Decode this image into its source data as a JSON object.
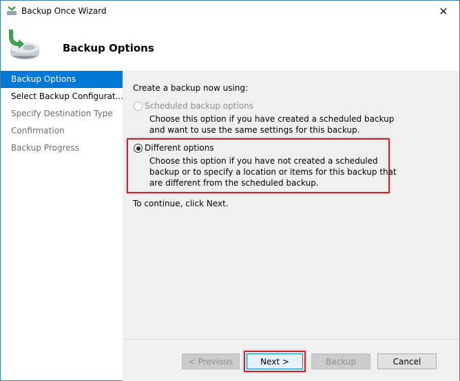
{
  "window": {
    "title": "Backup Once Wizard"
  },
  "header": {
    "title": "Backup Options"
  },
  "sidebar": {
    "items": [
      {
        "label": "Backup Options",
        "state": "active"
      },
      {
        "label": "Select Backup Configurat...",
        "state": "normal"
      },
      {
        "label": "Specify Destination Type",
        "state": "disabled"
      },
      {
        "label": "Confirmation",
        "state": "disabled"
      },
      {
        "label": "Backup Progress",
        "state": "disabled"
      }
    ]
  },
  "content": {
    "intro": "Create a backup now using:",
    "options": [
      {
        "label": "Scheduled backup options",
        "description": "Choose this option if you have created a scheduled backup and want to use the same settings for this backup.",
        "enabled": false,
        "selected": false
      },
      {
        "label": "Different options",
        "description": "Choose this option if you have not created a scheduled backup or to specify a location or items for this backup that are different from the scheduled backup.",
        "enabled": true,
        "selected": true
      }
    ],
    "continue_text": "To continue, click Next."
  },
  "buttons": {
    "previous": "< Previous",
    "next": "Next >",
    "backup": "Backup",
    "cancel": "Cancel"
  },
  "colors": {
    "accent": "#0078d7",
    "highlight": "#c8262d"
  }
}
